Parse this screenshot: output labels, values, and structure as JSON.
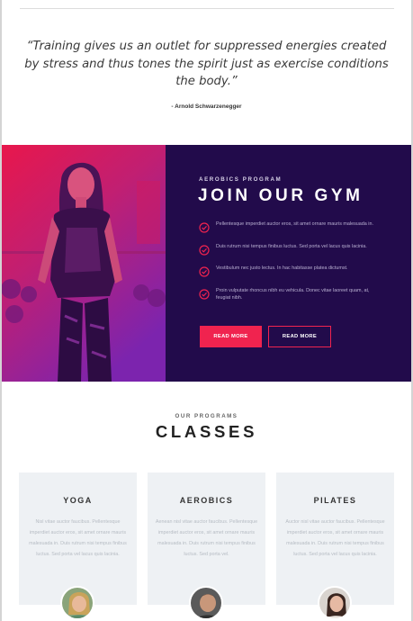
{
  "quote": {
    "text": "“Training gives us an outlet for suppressed energies created by stress and thus tones the spirit just as exercise conditions the body.”",
    "author": "- Arnold Schwarzenegger"
  },
  "gym": {
    "kicker": "AEROBICS PROGRAM",
    "title": "JOIN OUR GYM",
    "items": [
      {
        "text": "Pellentesque imperdiet auctor eros, sit amet ornare mauris malesuada in."
      },
      {
        "text": "Duis rutrum nisi tempus finibus luctus. Sed porta vel lacus quis lacinia."
      },
      {
        "text": "Vestibulum nec justo lectus. In hac habitasse platea dictumst."
      },
      {
        "text": "Proin vulputate rhoncus nibh eu vehicula. Donec vitae laoreet quam, at, feugiat nibh."
      }
    ],
    "primary_button": "READ MORE",
    "secondary_button": "READ MORE",
    "accent_color": "#f0234f",
    "panel_color": "#220b4b"
  },
  "classes": {
    "kicker": "OUR PROGRAMS",
    "title": "CLASSES",
    "cards": [
      {
        "title": "YOGA",
        "text": "Nisl vitae auctor faucibus. Pellentesque imperdiet auctor eros, sit amet ornare mauris malesuada in. Duis rutrum nisi tempus finibus luctus. Sed porta vel lacus quis lacinia."
      },
      {
        "title": "AEROBICS",
        "text": "Aenean nisl vitae auctor faucibus. Pellentesque imperdiet auctor eros, sit amet ornare mauris malesuada in. Duis rutrum nisi tempus finibus luctus. Sed porta vel."
      },
      {
        "title": "PILATES",
        "text": "Auctor nisl vitae auctor faucibus. Pellentesque imperdiet auctor eros, sit amet ornare mauris malesuada in. Duis rutrum nisi tempus finibus luctus. Sed porta vel lacus quis lacinia."
      }
    ]
  }
}
